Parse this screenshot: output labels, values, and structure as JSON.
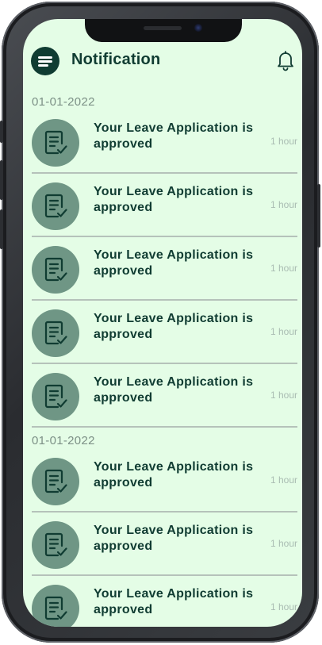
{
  "header": {
    "title": "Notification",
    "menu_icon": "hamburger-menu-icon",
    "bell_icon": "bell-icon"
  },
  "groups": [
    {
      "date": "01-01-2022",
      "items": [
        {
          "message": "Your Leave Application is approved",
          "time": "1 hour",
          "icon": "document-check-icon"
        },
        {
          "message": "Your Leave Application is approved",
          "time": "1 hour",
          "icon": "document-check-icon"
        },
        {
          "message": "Your Leave Application is approved",
          "time": "1 hour",
          "icon": "document-check-icon"
        },
        {
          "message": "Your Leave Application is approved",
          "time": "1 hour",
          "icon": "document-check-icon"
        },
        {
          "message": "Your Leave Application is approved",
          "time": "1 hour",
          "icon": "document-check-icon"
        }
      ]
    },
    {
      "date": "01-01-2022",
      "items": [
        {
          "message": "Your Leave Application is approved",
          "time": "1 hour",
          "icon": "document-check-icon"
        },
        {
          "message": "Your Leave Application is approved",
          "time": "1 hour",
          "icon": "document-check-icon"
        },
        {
          "message": "Your Leave Application is approved",
          "time": "1 hour",
          "icon": "document-check-icon"
        }
      ]
    }
  ],
  "colors": {
    "background": "#e4fde6",
    "primary": "#103c32",
    "avatar": "#6f9685",
    "date_text": "#7c9086",
    "time_text": "#a9bcb2"
  }
}
